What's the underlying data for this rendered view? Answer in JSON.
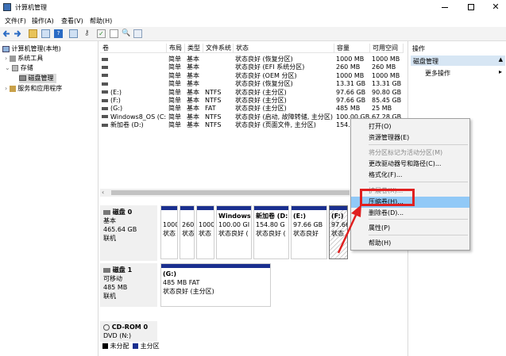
{
  "window": {
    "title": "计算机管理"
  },
  "menu": [
    "文件(F)",
    "操作(A)",
    "查看(V)",
    "帮助(H)"
  ],
  "tree": {
    "root": "计算机管理(本地)",
    "system_tools": "系统工具",
    "storage": "存储",
    "disk_mgmt": "磁盘管理",
    "services": "服务和应用程序"
  },
  "columns": [
    "卷",
    "布局",
    "类型",
    "文件系统",
    "状态",
    "容量",
    "可用空间"
  ],
  "volumes": [
    {
      "name": "",
      "layout": "简单",
      "type": "基本",
      "fs": "",
      "status": "状态良好 (恢复分区)",
      "cap": "1000 MB",
      "free": "1000 MB"
    },
    {
      "name": "",
      "layout": "简单",
      "type": "基本",
      "fs": "",
      "status": "状态良好 (EFI 系统分区)",
      "cap": "260 MB",
      "free": "260 MB"
    },
    {
      "name": "",
      "layout": "简单",
      "type": "基本",
      "fs": "",
      "status": "状态良好 (OEM 分区)",
      "cap": "1000 MB",
      "free": "1000 MB"
    },
    {
      "name": "",
      "layout": "简单",
      "type": "基本",
      "fs": "",
      "status": "状态良好 (恢复分区)",
      "cap": "13.31 GB",
      "free": "13.31 GB"
    },
    {
      "name": "(E:)",
      "layout": "简单",
      "type": "基本",
      "fs": "NTFS",
      "status": "状态良好 (主分区)",
      "cap": "97.66 GB",
      "free": "90.80 GB"
    },
    {
      "name": "(F:)",
      "layout": "简单",
      "type": "基本",
      "fs": "NTFS",
      "status": "状态良好 (主分区)",
      "cap": "97.66 GB",
      "free": "85.45 GB"
    },
    {
      "name": "(G:)",
      "layout": "简单",
      "type": "基本",
      "fs": "FAT",
      "status": "状态良好 (主分区)",
      "cap": "485 MB",
      "free": "25 MB"
    },
    {
      "name": "Windows8_OS (C:)",
      "layout": "简单",
      "type": "基本",
      "fs": "NTFS",
      "status": "状态良好 (启动, 故障转储, 主分区)",
      "cap": "100.00 GB",
      "free": "67.28 GB"
    },
    {
      "name": "新加卷 (D:)",
      "layout": "简单",
      "type": "基本",
      "fs": "NTFS",
      "status": "状态良好 (页面文件, 主分区)",
      "cap": "154.",
      "free": ""
    }
  ],
  "disk0": {
    "name": "磁盘 0",
    "type": "基本",
    "size": "465.64 GB",
    "state": "联机",
    "parts": [
      {
        "l1": "",
        "l2": "1000",
        "l3": "状态"
      },
      {
        "l1": "",
        "l2": "260",
        "l3": "状态"
      },
      {
        "l1": "",
        "l2": "1000",
        "l3": "状态"
      },
      {
        "l1": "Windows",
        "l2": "100.00 GI",
        "l3": "状态良好 ("
      },
      {
        "l1": "新加卷 (D:)",
        "l2": "154.80 G",
        "l3": "状态良好 ("
      },
      {
        "l1": "(E:)",
        "l2": "97.66 GB",
        "l3": "状态良好"
      },
      {
        "l1": "(F:)",
        "l2": "97.66",
        "l3": "状态"
      }
    ]
  },
  "disk1": {
    "name": "磁盘 1",
    "type": "可移动",
    "size": "485 MB",
    "state": "联机",
    "part": {
      "l1": "(G:)",
      "l2": "485 MB FAT",
      "l3": "状态良好 (主分区)"
    }
  },
  "cdrom": {
    "name": "CD-ROM 0",
    "sub": "DVD (N:)"
  },
  "legend": {
    "unallocated": "未分配",
    "primary": "主分区"
  },
  "actions": {
    "title": "操作",
    "section": "磁盘管理",
    "more": "更多操作"
  },
  "context_menu": [
    {
      "label": "打开(O)",
      "enabled": true
    },
    {
      "label": "资源管理器(E)",
      "enabled": true
    },
    {
      "label": "将分区标记为活动分区(M)",
      "enabled": false
    },
    {
      "label": "更改驱动器号和路径(C)...",
      "enabled": true
    },
    {
      "label": "格式化(F)...",
      "enabled": true
    },
    {
      "label": "扩展卷(X)...",
      "enabled": false
    },
    {
      "label": "压缩卷(H)...",
      "enabled": true
    },
    {
      "label": "删除卷(D)...",
      "enabled": true
    },
    {
      "label": "属性(P)",
      "enabled": true
    },
    {
      "label": "帮助(H)",
      "enabled": true
    }
  ],
  "colors": {
    "primary_partition": "#1a2f8f",
    "highlight": "#e02020",
    "menu_hover": "#91c9f7"
  }
}
